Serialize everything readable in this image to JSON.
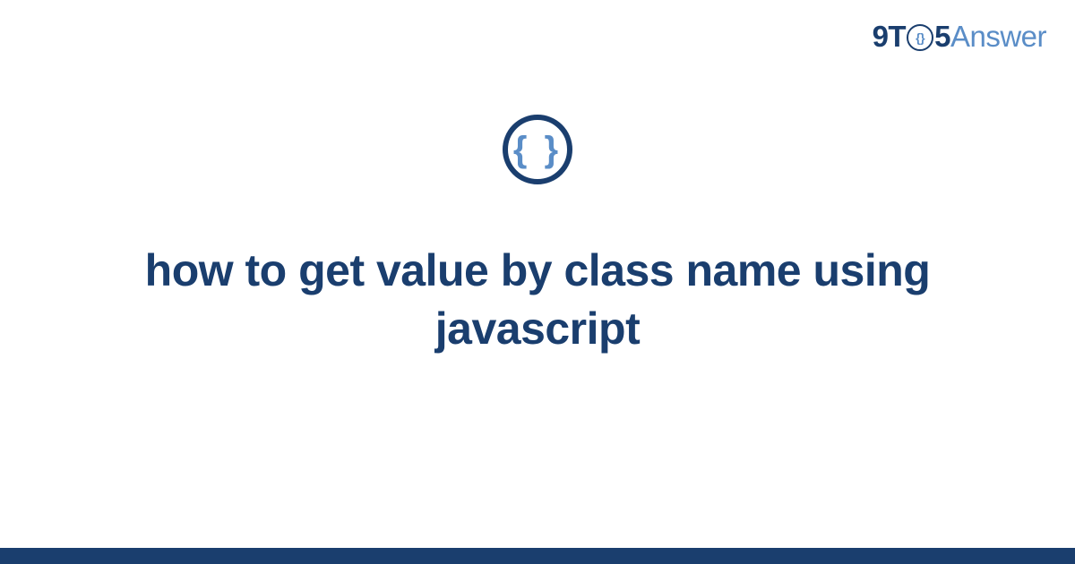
{
  "logo": {
    "part1": "9T",
    "clock_inner": "{}",
    "part2": "5",
    "part3": "Answer"
  },
  "category_icon": {
    "symbol": "{ }",
    "name": "code-braces"
  },
  "title": "how to get value by class name using javascript",
  "colors": {
    "primary": "#1a3e6e",
    "accent": "#5a8dc7",
    "background": "#ffffff"
  }
}
